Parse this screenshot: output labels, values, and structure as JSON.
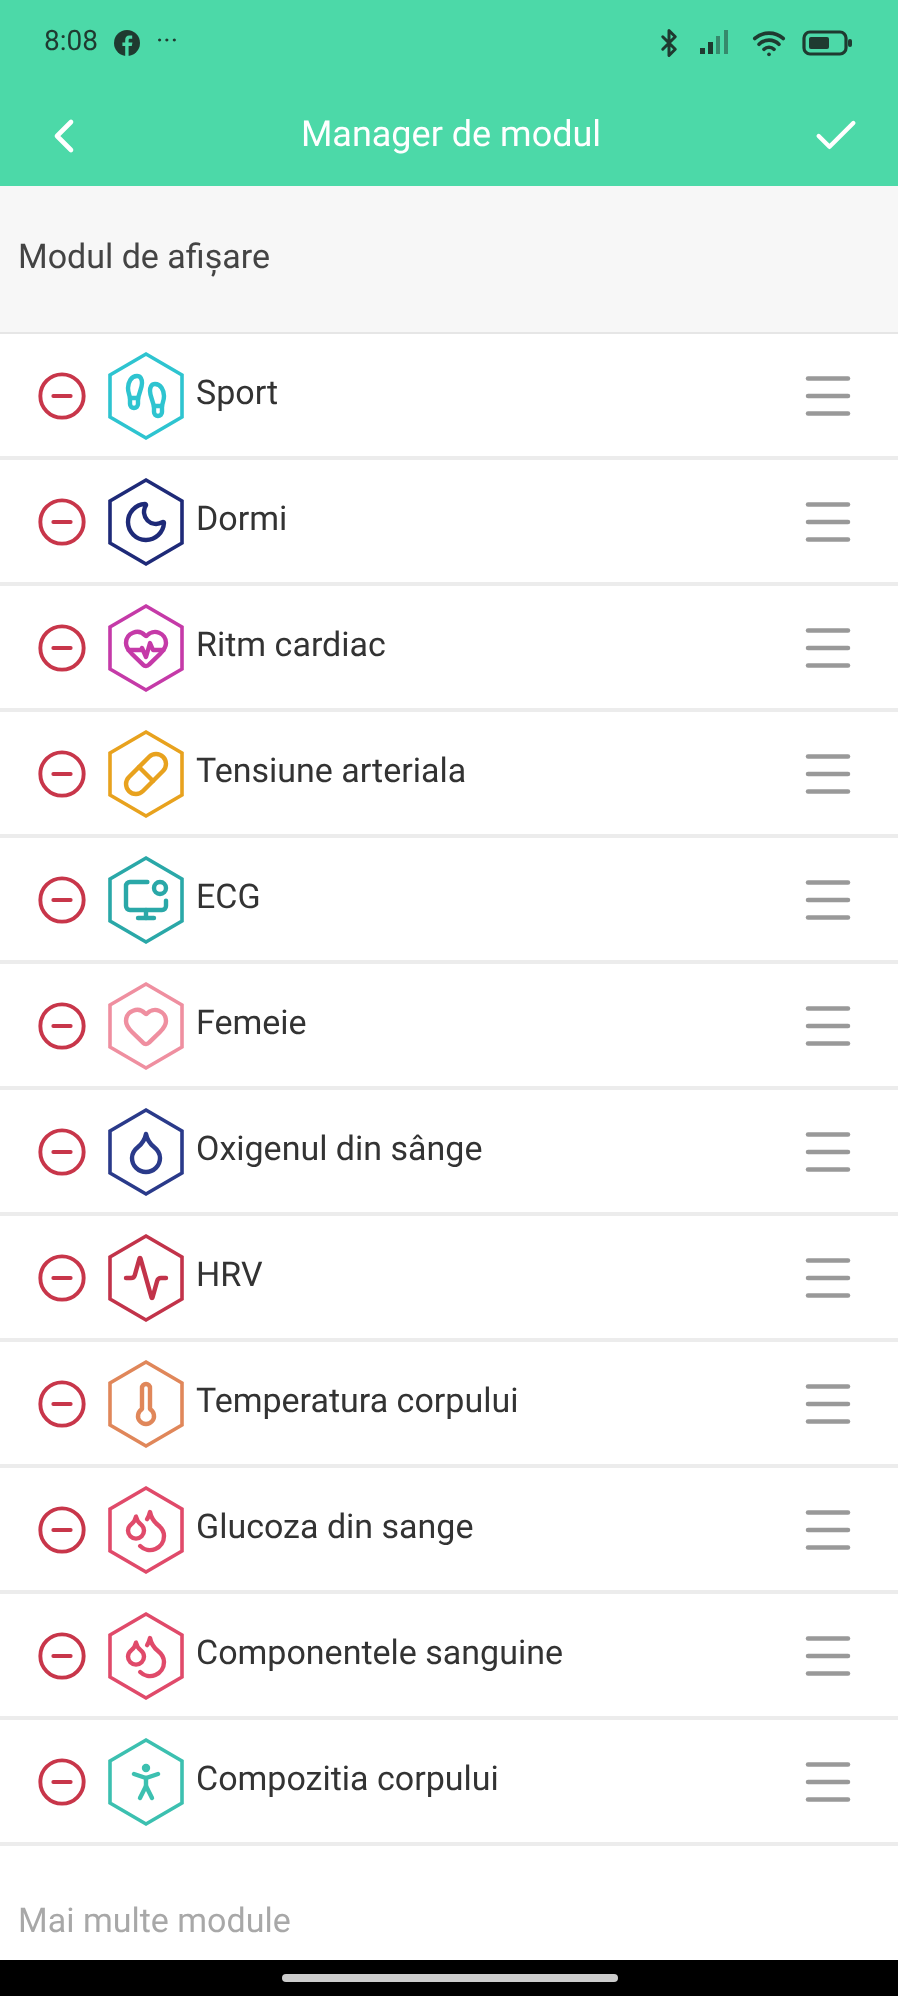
{
  "status_bar": {
    "time": "8:08",
    "more": "···"
  },
  "header": {
    "title": "Manager de modul"
  },
  "section": {
    "title": "Modul de afișare"
  },
  "modules": [
    {
      "label": "Sport",
      "kind": "footprints",
      "color": "#2ec4d0"
    },
    {
      "label": "Dormi",
      "kind": "moon",
      "color": "#1e2a78"
    },
    {
      "label": "Ritm cardiac",
      "kind": "heart-pulse",
      "color": "#c53aa8"
    },
    {
      "label": "Tensiune arteriala",
      "kind": "pills",
      "color": "#e8a21e"
    },
    {
      "label": "ECG",
      "kind": "ecg",
      "color": "#2aa8a8"
    },
    {
      "label": "Femeie",
      "kind": "heart",
      "color": "#ef8fa0"
    },
    {
      "label": "Oxigenul din sânge",
      "kind": "drop",
      "color": "#2a3a8a"
    },
    {
      "label": "HRV",
      "kind": "pulse",
      "color": "#c2334a"
    },
    {
      "label": "Temperatura corpului",
      "kind": "thermometer",
      "color": "#e0875a"
    },
    {
      "label": "Glucoza din sange",
      "kind": "drops",
      "color": "#e04a6a"
    },
    {
      "label": "Componentele sanguine",
      "kind": "drops",
      "color": "#e04a6a"
    },
    {
      "label": "Compozitia corpului",
      "kind": "person",
      "color": "#3cc0b0"
    }
  ],
  "more_section": {
    "title": "Mai multe module"
  }
}
